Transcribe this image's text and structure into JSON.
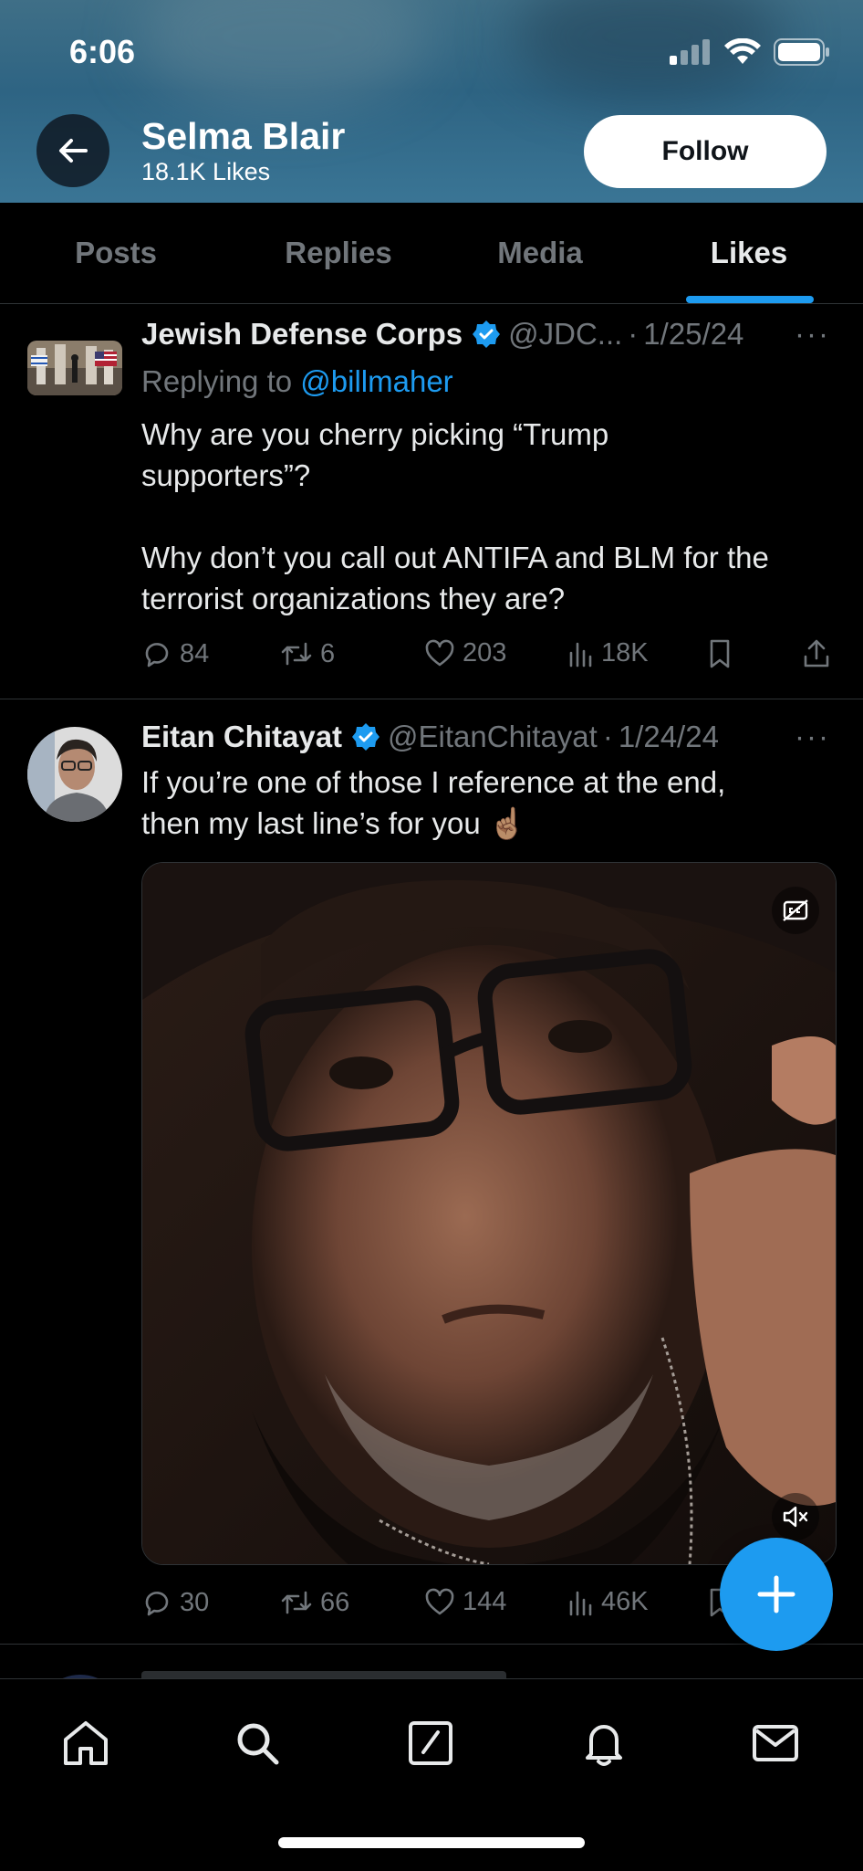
{
  "status_bar": {
    "time": "6:06"
  },
  "header": {
    "profile_name": "Selma Blair",
    "profile_subtitle": "18.1K Likes",
    "follow_label": "Follow"
  },
  "tabs": [
    {
      "label": "Posts",
      "active": false
    },
    {
      "label": "Replies",
      "active": false
    },
    {
      "label": "Media",
      "active": false
    },
    {
      "label": "Likes",
      "active": true
    }
  ],
  "tweets": [
    {
      "name": "Jewish Defense Corps",
      "verified": true,
      "handle": "@JDC...",
      "separator": "·",
      "date": "1/25/24",
      "more": "···",
      "replying_prefix": "Replying to",
      "replying_to": "@billmaher",
      "text": "Why are you cherry picking “Trump\nsupporters”?\n\nWhy don’t you call out ANTIFA and BLM for the\nterrorist organizations they are?",
      "replies": "84",
      "reposts": "6",
      "likes": "203",
      "views": "18K"
    },
    {
      "name": "Eitan Chitayat",
      "verified": true,
      "handle": "@EitanChitayat",
      "separator": "·",
      "date": "1/24/24",
      "more": "···",
      "text": "If you’re one of those I reference at the end,\nthen my last line’s for you ",
      "emoji": "☝🏽",
      "has_video": true,
      "replies": "30",
      "reposts": "66",
      "likes": "144",
      "views": "46K"
    }
  ],
  "colors": {
    "accent": "#1d9bf0",
    "background": "#000000",
    "text_primary": "#e7e9ea",
    "text_secondary": "#71767b",
    "divider": "#2f3336"
  },
  "bottom_nav": {
    "items": [
      "home-icon",
      "search-icon",
      "compose-icon",
      "bell-icon",
      "mail-icon"
    ]
  }
}
